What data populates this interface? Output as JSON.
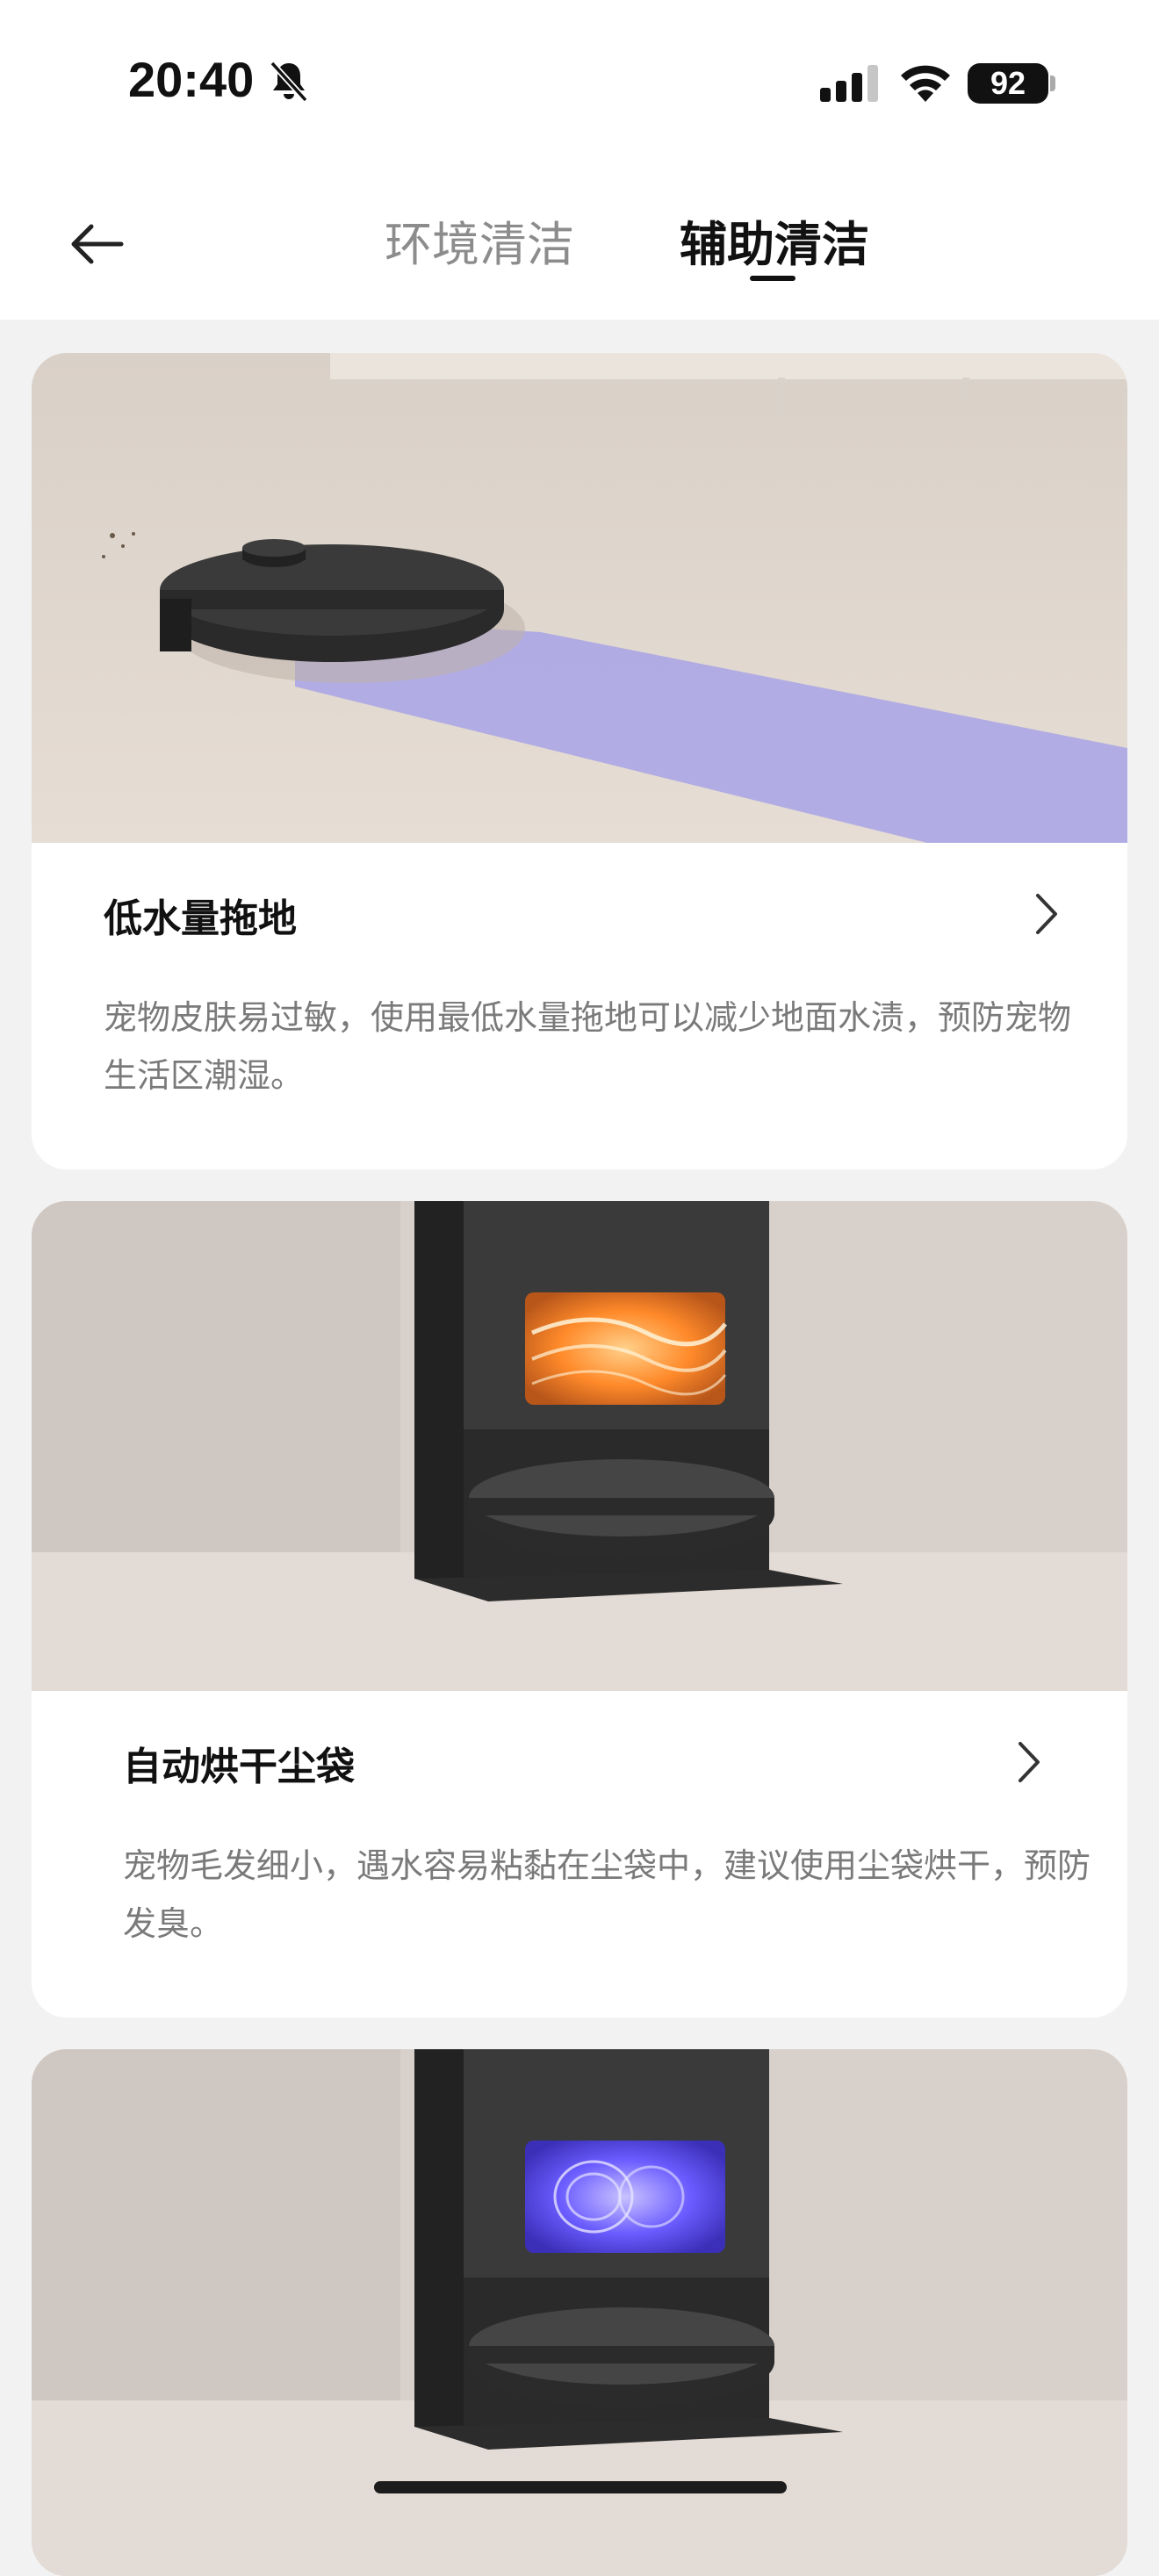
{
  "status": {
    "time": "20:40",
    "battery": "92",
    "icons": [
      "bell-muted-icon",
      "cellular-signal-icon",
      "wifi-icon",
      "battery-icon"
    ]
  },
  "header": {
    "back_icon": "arrow-left-icon",
    "tabs": [
      {
        "label": "环境清洁",
        "active": false
      },
      {
        "label": "辅助清洁",
        "active": true
      }
    ]
  },
  "cards": [
    {
      "title": "低水量拖地",
      "description": "宠物皮肤易过敏，使用最低水量拖地可以减少地面水渍，预防宠物生活区潮湿。",
      "image": "robot-mopping-image"
    },
    {
      "title": "自动烘干尘袋",
      "description": "宠物毛发细小，遇水容易粘黏在尘袋中，建议使用尘袋烘干，预防发臭。",
      "image": "dock-drying-image"
    },
    {
      "title": "",
      "description": "",
      "image": "dock-sterilizing-image"
    }
  ],
  "colors": {
    "accent_orange": "#ff8a2a",
    "accent_purple": "#6a5cff",
    "mop_path": "#a8a3e6"
  }
}
